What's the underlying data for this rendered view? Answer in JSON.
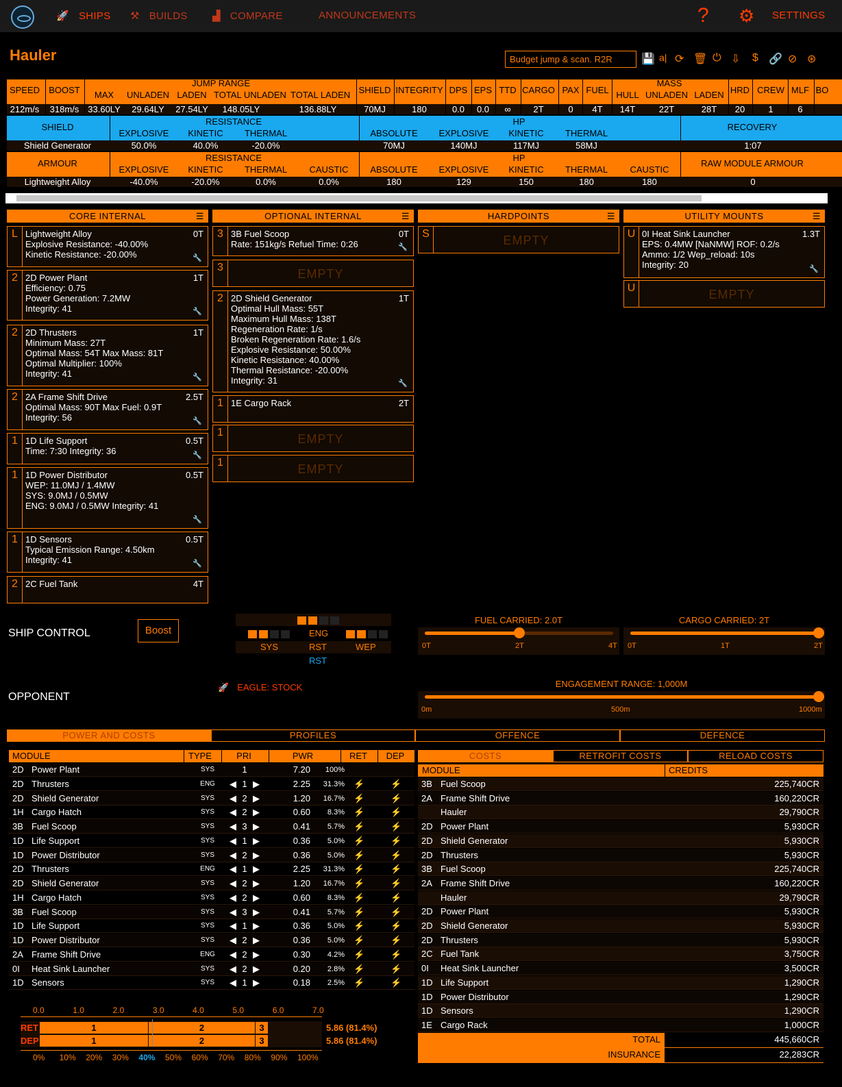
{
  "nav": {
    "ships": "SHIPS",
    "builds": "BUILDS",
    "compare": "COMPARE",
    "announcements": "ANNOUNCEMENTS",
    "help": "?",
    "settings": "SETTINGS"
  },
  "ship": {
    "title": "Hauler",
    "build_name": "Budget jump & scan. R2R"
  },
  "stats": {
    "headers": [
      "SPEED",
      "BOOST",
      "JUMP RANGE",
      "MAX",
      "UNLADEN",
      "LADEN",
      "TOTAL UNLADEN",
      "TOTAL LADEN",
      "SHIELD",
      "INTEGRITY",
      "DPS",
      "EPS",
      "TTD",
      "CARGO",
      "PAX",
      "FUEL",
      "MASS",
      "HULL",
      "UNLADEN",
      "LADEN",
      "HRD",
      "CREW",
      "MLF",
      "BO"
    ],
    "values": [
      "212m/s",
      "318m/s",
      "33.60LY",
      "29.64LY",
      "27.54LY",
      "148.05LY",
      "136.88LY",
      "70MJ",
      "180",
      "0.0",
      "0.0",
      "∞",
      "2T",
      "0",
      "4T",
      "14T",
      "22T",
      "28T",
      "20",
      "1",
      "6"
    ]
  },
  "shield": {
    "label": "SHIELD",
    "resistance": "RESISTANCE",
    "hp": "HP",
    "recovery": "RECOVERY",
    "cols": [
      "EXPLOSIVE",
      "KINETIC",
      "THERMAL",
      "ABSOLUTE",
      "EXPLOSIVE",
      "KINETIC",
      "THERMAL"
    ],
    "name": "Shield Generator",
    "values": [
      "50.0%",
      "40.0%",
      "-20.0%",
      "70MJ",
      "140MJ",
      "117MJ",
      "58MJ",
      "1:07"
    ]
  },
  "armour": {
    "label": "ARMOUR",
    "resistance": "RESISTANCE",
    "hp": "HP",
    "raw": "RAW MODULE ARMOUR",
    "cols": [
      "EXPLOSIVE",
      "KINETIC",
      "THERMAL",
      "CAUSTIC",
      "ABSOLUTE",
      "EXPLOSIVE",
      "KINETIC",
      "THERMAL",
      "CAUSTIC"
    ],
    "name": "Lightweight Alloy",
    "values": [
      "-40.0%",
      "-20.0%",
      "0.0%",
      "0.0%",
      "180",
      "129",
      "150",
      "180",
      "180",
      "0"
    ]
  },
  "sections": {
    "core": "CORE INTERNAL",
    "optional": "OPTIONAL INTERNAL",
    "hardpoints": "HARDPOINTS",
    "utility": "UTILITY MOUNTS"
  },
  "core": [
    {
      "cls": "L",
      "wt": "0T",
      "lines": [
        "Lightweight Alloy",
        "Explosive Resistance: -40.00%",
        "Kinetic Resistance: -20.00%"
      ]
    },
    {
      "cls": "2",
      "wt": "1T",
      "lines": [
        "2D Power Plant",
        "Efficiency: 0.75",
        "Power Generation: 7.2MW",
        "Integrity: 41"
      ]
    },
    {
      "cls": "2",
      "wt": "1T",
      "lines": [
        "2D Thrusters",
        "Minimum Mass: 27T",
        "Optimal Mass: 54T   Max Mass: 81T",
        "Optimal Multiplier: 100%",
        "Integrity: 41"
      ]
    },
    {
      "cls": "2",
      "wt": "2.5T",
      "lines": [
        "2A Frame Shift Drive",
        "Optimal Mass: 90T   Max Fuel: 0.9T",
        "Integrity: 56"
      ]
    },
    {
      "cls": "1",
      "wt": "0.5T",
      "lines": [
        "1D Life Support",
        "Time: 7:30   Integrity: 36"
      ]
    },
    {
      "cls": "1",
      "wt": "0.5T",
      "lines": [
        "1D Power Distributor",
        "WEP: 11.0MJ / 1.4MW",
        "SYS: 9.0MJ / 0.5MW",
        "ENG: 9.0MJ / 0.5MW   Integrity: 41"
      ]
    },
    {
      "cls": "1",
      "wt": "0.5T",
      "lines": [
        "1D Sensors",
        "Typical Emission Range: 4.50km",
        "Integrity: 41"
      ]
    },
    {
      "cls": "2",
      "wt": "4T",
      "lines": [
        "2C Fuel Tank"
      ]
    }
  ],
  "optional": [
    {
      "cls": "3",
      "wt": "0T",
      "lines": [
        "3B Fuel Scoop",
        "Rate: 151kg/s   Refuel Time: 0:26"
      ]
    },
    {
      "cls": "3",
      "empty": "EMPTY"
    },
    {
      "cls": "2",
      "wt": "1T",
      "lines": [
        "2D Shield Generator",
        "Optimal Hull Mass: 55T",
        "Maximum Hull Mass: 138T",
        "Regeneration Rate: 1/s",
        "Broken Regeneration Rate: 1.6/s",
        "Explosive Resistance: 50.00%",
        "Kinetic Resistance: 40.00%",
        "Thermal Resistance: -20.00%",
        "Integrity: 31"
      ]
    },
    {
      "cls": "1",
      "wt": "2T",
      "lines": [
        "1E Cargo Rack"
      ]
    },
    {
      "cls": "1",
      "empty": "EMPTY"
    },
    {
      "cls": "1",
      "empty": "EMPTY"
    }
  ],
  "hardpoints": [
    {
      "cls": "S",
      "empty": "EMPTY"
    }
  ],
  "utility": [
    {
      "cls": "U",
      "wt": "1.3T",
      "lines": [
        "0I Heat Sink Launcher",
        "EPS: 0.4MW [NaNMW]   ROF: 0.2/s",
        "Ammo: 1/2   Wep_reload: 10s",
        "Integrity: 20"
      ]
    },
    {
      "cls": "U",
      "empty": "EMPTY"
    }
  ],
  "control": {
    "label": "SHIP CONTROL",
    "boost": "Boost",
    "eng": "ENG",
    "sys": "SYS",
    "rst": "RST",
    "wep": "WEP",
    "rst2": "RST",
    "fuel_label": "FUEL CARRIED: 2.0T",
    "fuel": 0.5,
    "fuel_ticks": [
      "0T",
      "2T",
      "4T"
    ],
    "cargo_label": "CARGO CARRIED: 2T",
    "cargo": 1.0,
    "cargo_ticks": [
      "0T",
      "1T",
      "2T"
    ]
  },
  "opponent": {
    "label": "OPPONENT",
    "ship": "EAGLE: STOCK",
    "range_label": "ENGAGEMENT RANGE: 1,000M",
    "range": 1.0,
    "range_ticks": [
      "0m",
      "500m",
      "1000m"
    ]
  },
  "tabs": [
    "POWER AND COSTS",
    "PROFILES",
    "OFFENCE",
    "DEFENCE"
  ],
  "power": {
    "headers": [
      "MODULE",
      "TYPE",
      "PRI",
      "PWR",
      "RET",
      "DEP"
    ],
    "rows": [
      [
        "2D",
        "Power Plant",
        "SYS",
        "1",
        "7.20",
        "100%",
        ""
      ],
      [
        "2D",
        "Thrusters",
        "ENG",
        "1",
        "2.25",
        "31.3%",
        "b"
      ],
      [
        "2D",
        "Shield Generator",
        "SYS",
        "2",
        "1.20",
        "16.7%",
        "b"
      ],
      [
        "1H",
        "Cargo Hatch",
        "SYS",
        "2",
        "0.60",
        "8.3%",
        "b"
      ],
      [
        "3B",
        "Fuel Scoop",
        "SYS",
        "3",
        "0.41",
        "5.7%",
        "b"
      ],
      [
        "1D",
        "Life Support",
        "SYS",
        "1",
        "0.36",
        "5.0%",
        "b"
      ],
      [
        "1D",
        "Power Distributor",
        "SYS",
        "2",
        "0.36",
        "5.0%",
        "b"
      ],
      [
        "2D",
        "Thrusters",
        "ENG",
        "1",
        "2.25",
        "31.3%",
        "b"
      ],
      [
        "2D",
        "Shield Generator",
        "SYS",
        "2",
        "1.20",
        "16.7%",
        "b"
      ],
      [
        "1H",
        "Cargo Hatch",
        "SYS",
        "2",
        "0.60",
        "8.3%",
        "b"
      ],
      [
        "3B",
        "Fuel Scoop",
        "SYS",
        "3",
        "0.41",
        "5.7%",
        "b"
      ],
      [
        "1D",
        "Life Support",
        "SYS",
        "1",
        "0.36",
        "5.0%",
        "b"
      ],
      [
        "1D",
        "Power Distributor",
        "SYS",
        "2",
        "0.36",
        "5.0%",
        "b"
      ],
      [
        "2A",
        "Frame Shift Drive",
        "ENG",
        "2",
        "0.30",
        "4.2%",
        "b"
      ],
      [
        "0I",
        "Heat Sink Launcher",
        "SYS",
        "2",
        "0.20",
        "2.8%",
        "b"
      ],
      [
        "1D",
        "Sensors",
        "SYS",
        "1",
        "0.18",
        "2.5%",
        "b"
      ]
    ]
  },
  "powerbar": {
    "top_ticks": [
      "0.0",
      "1.0",
      "2.0",
      "3.0",
      "4.0",
      "5.0",
      "6.0",
      "7.0"
    ],
    "bottom_ticks": [
      "0%",
      "10%",
      "20%",
      "30%",
      "40%",
      "50%",
      "60%",
      "70%",
      "80%",
      "90%",
      "100%"
    ],
    "ret_label": "RET",
    "dep_label": "DEP",
    "ret_value": "5.86 (81.4%)",
    "dep_value": "5.86 (81.4%)",
    "segments": [
      "1",
      "2",
      "3"
    ]
  },
  "costs": {
    "tabs": [
      "COSTS",
      "RETROFIT COSTS",
      "RELOAD COSTS"
    ],
    "headers": [
      "MODULE",
      "CREDITS"
    ],
    "rows": [
      [
        "3B",
        "Fuel Scoop",
        "225,740CR"
      ],
      [
        "2A",
        "Frame Shift Drive",
        "160,220CR"
      ],
      [
        "",
        "Hauler",
        "29,790CR"
      ],
      [
        "2D",
        "Power Plant",
        "5,930CR"
      ],
      [
        "2D",
        "Shield Generator",
        "5,930CR"
      ],
      [
        "2D",
        "Thrusters",
        "5,930CR"
      ],
      [
        "3B",
        "Fuel Scoop",
        "225,740CR"
      ],
      [
        "2A",
        "Frame Shift Drive",
        "160,220CR"
      ],
      [
        "",
        "Hauler",
        "29,790CR"
      ],
      [
        "2D",
        "Power Plant",
        "5,930CR"
      ],
      [
        "2D",
        "Shield Generator",
        "5,930CR"
      ],
      [
        "2D",
        "Thrusters",
        "5,930CR"
      ],
      [
        "2C",
        "Fuel Tank",
        "3,750CR"
      ],
      [
        "0I",
        "Heat Sink Launcher",
        "3,500CR"
      ],
      [
        "1D",
        "Life Support",
        "1,290CR"
      ],
      [
        "1D",
        "Power Distributor",
        "1,290CR"
      ],
      [
        "1D",
        "Sensors",
        "1,290CR"
      ],
      [
        "1E",
        "Cargo Rack",
        "1,000CR"
      ]
    ],
    "total_label": "TOTAL",
    "total": "445,660CR",
    "insurance_label": "INSURANCE",
    "insurance": "22,283CR"
  }
}
